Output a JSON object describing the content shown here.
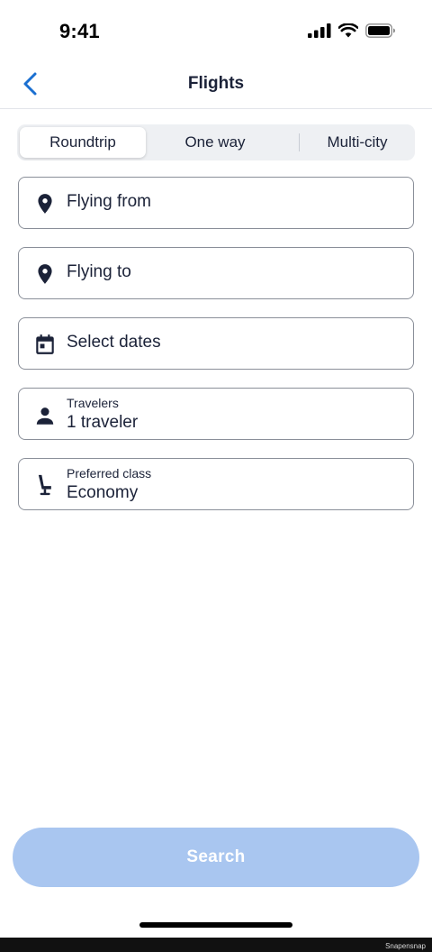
{
  "status_bar": {
    "time": "9:41",
    "signal_icon": "cellular-signal-icon",
    "wifi_icon": "wifi-icon",
    "battery_icon": "battery-icon"
  },
  "nav": {
    "title": "Flights",
    "back_icon": "chevron-left-icon"
  },
  "trip_types": {
    "options": [
      "Roundtrip",
      "One way",
      "Multi-city"
    ],
    "selected": "Roundtrip"
  },
  "fields": {
    "from": {
      "placeholder": "Flying from",
      "icon": "location-pin-icon"
    },
    "to": {
      "placeholder": "Flying to",
      "icon": "location-pin-icon"
    },
    "dates": {
      "placeholder": "Select dates",
      "icon": "calendar-icon"
    },
    "travelers": {
      "label": "Travelers",
      "value": "1 traveler",
      "icon": "person-icon"
    },
    "cabin_class": {
      "label": "Preferred class",
      "value": "Economy",
      "icon": "seat-icon"
    }
  },
  "search_button": {
    "label": "Search",
    "state": "disabled"
  },
  "watermark": "Snapensnap",
  "colors": {
    "accent": "#1a6fd1",
    "text": "#1b2238",
    "search_disabled": "#a9c6f0",
    "border": "#8a8f99"
  }
}
